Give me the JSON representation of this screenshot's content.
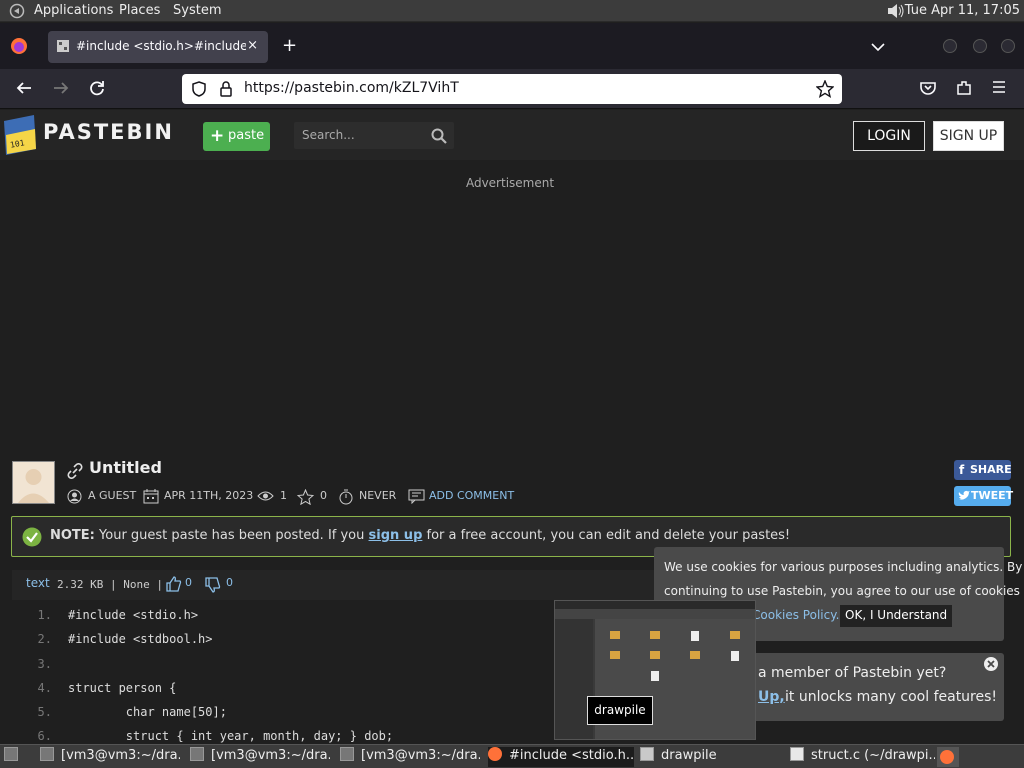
{
  "panel": {
    "applications": "Applications",
    "places": "Places",
    "system": "System",
    "clock": "Tue Apr 11, 17:05"
  },
  "browser": {
    "tab_title": "#include <stdio.h>#include <stdbool.h>",
    "tab_close": "×",
    "new_tab": "+",
    "url": "https://pastebin.com/kZL7VihT"
  },
  "site": {
    "logo": "PASTEBIN",
    "paste_btn": "paste",
    "search_placeholder": "Search...",
    "login": "LOGIN",
    "signup": "SIGN UP",
    "ad_label": "Advertisement"
  },
  "paste": {
    "title": "Untitled",
    "author": "A GUEST",
    "date": "APR 11TH, 2023",
    "views": "1",
    "stars": "0",
    "expiry": "NEVER",
    "add_comment": "ADD COMMENT",
    "share": "SHARE",
    "tweet": "TWEET"
  },
  "note": {
    "label": "NOTE:",
    "before": "Your guest paste has been posted. If you",
    "link": "sign up",
    "after": "for a free account, you can edit and delete your pastes!"
  },
  "code_header": {
    "syntax": "text",
    "meta": "2.32 KB | None |",
    "likes": "0",
    "dislikes": "0"
  },
  "code_lines": [
    {
      "n": "1.",
      "t": "#include <stdio.h>"
    },
    {
      "n": "2.",
      "t": "#include <stdbool.h>"
    },
    {
      "n": "3.",
      "t": ""
    },
    {
      "n": "4.",
      "t": "struct person {"
    },
    {
      "n": "5.",
      "t": "        char name[50];"
    },
    {
      "n": "6.",
      "t": "        struct { int year, month, day; } dob;"
    }
  ],
  "cookie": {
    "text1": "We use cookies for various purposes including analytics. By",
    "text2": "continuing to use Pastebin, you agree to our use of cookies as",
    "policy": "Cookies Policy.",
    "ok": "OK, I Understand"
  },
  "member": {
    "line1": "a member of Pastebin yet?",
    "link": "Up,",
    "line2": "it unlocks many cool features!"
  },
  "tooltip": "drawpile",
  "taskbar": [
    {
      "label": "[vm3@vm3:~/dra..."
    },
    {
      "label": "[vm3@vm3:~/dra..."
    },
    {
      "label": "[vm3@vm3:~/dra..."
    },
    {
      "label": "#include <stdio.h..."
    },
    {
      "label": "drawpile"
    },
    {
      "label": "struct.c (~/drawpi..."
    }
  ],
  "colors": {
    "green": "#4caf50",
    "link": "#8cbfe8",
    "note_border": "#8bb44a",
    "facebook": "#3b5998",
    "twitter": "#55acee"
  }
}
